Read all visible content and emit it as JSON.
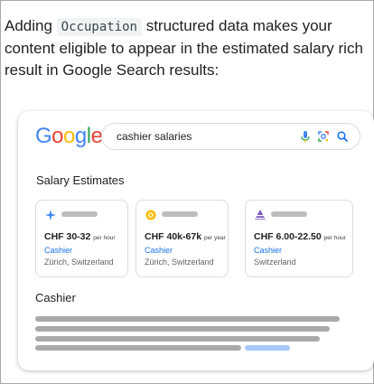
{
  "intro": {
    "before": "Adding ",
    "code": "Occupation",
    "after": " structured data makes your content eligible to appear in the estimated salary rich result in Google Search results:"
  },
  "search": {
    "logo": "Google",
    "query": "cashier salaries",
    "icons": [
      "mic-icon",
      "lens-icon",
      "search-icon"
    ]
  },
  "salary_estimates": {
    "heading": "Salary Estimates",
    "cards": [
      {
        "icon": "sparkle-icon",
        "amount": "CHF 30-32",
        "unit": "per hour",
        "title": "Cashier",
        "location": "Zürich, Switzerland"
      },
      {
        "icon": "coin-icon",
        "amount": "CHF 40k-67k",
        "unit": "per year",
        "title": "Cashier",
        "location": "Zürich, Switzerland"
      },
      {
        "icon": "pyramid-icon",
        "amount": "CHF 6.00-22.50",
        "unit": "per hour",
        "title": "Cashier",
        "location": "Switzerland"
      }
    ]
  },
  "result": {
    "heading": "Cashier"
  },
  "colors": {
    "link": "#1a73e8",
    "placeholder_bar": "#a9a9a9",
    "placeholder_link": "#a8c7fa"
  }
}
